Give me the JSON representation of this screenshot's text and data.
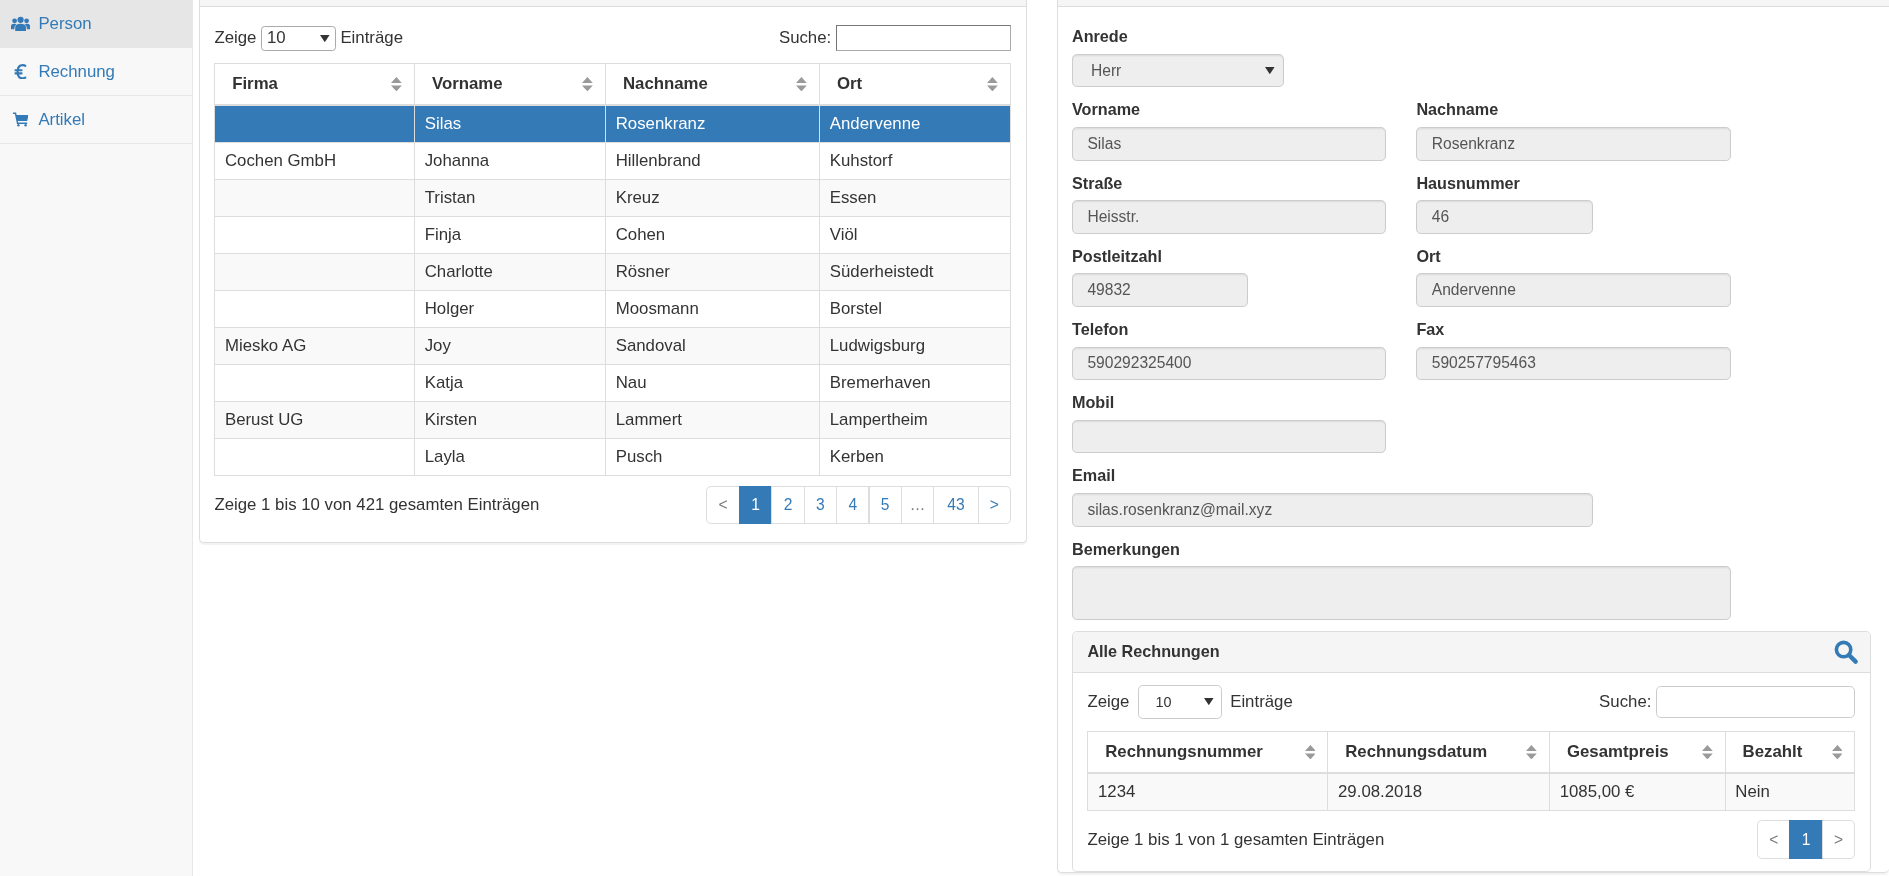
{
  "sidebar": {
    "items": [
      {
        "label": "Person",
        "selected": true
      },
      {
        "label": "Rechnung",
        "selected": false
      },
      {
        "label": "Artikel",
        "selected": false
      }
    ]
  },
  "persons": {
    "length": {
      "before": "Zeige",
      "value": "10",
      "after": "Einträge"
    },
    "search_label": "Suche:",
    "columns": [
      "Firma",
      "Vorname",
      "Nachname",
      "Ort"
    ],
    "rows": [
      {
        "vorname": "Silas",
        "nachname": "Rosenkranz",
        "ort": "Andervenne",
        "selected": true
      },
      {
        "firma": "Cochen GmbH",
        "vorname": "Johanna",
        "nachname": "Hillenbrand",
        "ort": "Kuhstorf",
        "selected": false
      },
      {
        "vorname": "Tristan",
        "nachname": "Kreuz",
        "ort": "Essen",
        "selected": false
      },
      {
        "vorname": "Finja",
        "nachname": "Cohen",
        "ort": "Viöl",
        "selected": false
      },
      {
        "vorname": "Charlotte",
        "nachname": "Rösner",
        "ort": "Süderheistedt",
        "selected": false
      },
      {
        "vorname": "Holger",
        "nachname": "Moosmann",
        "ort": "Borstel",
        "selected": false
      },
      {
        "firma": "Miesko AG",
        "vorname": "Joy",
        "nachname": "Sandoval",
        "ort": "Ludwigsburg",
        "selected": false
      },
      {
        "vorname": "Katja",
        "nachname": "Nau",
        "ort": "Bremerhaven",
        "selected": false
      },
      {
        "firma": "Berust UG",
        "vorname": "Kirsten",
        "nachname": "Lammert",
        "ort": "Lampertheim",
        "selected": false
      },
      {
        "vorname": "Layla",
        "nachname": "Pusch",
        "ort": "Kerben",
        "selected": false
      }
    ],
    "info": "Zeige 1 bis 10 von 421 gesamten Einträgen",
    "pagination": [
      {
        "label": "<",
        "selected": false,
        "disabled": true
      },
      {
        "label": "1",
        "selected": true,
        "disabled": false
      },
      {
        "label": "2",
        "selected": false,
        "disabled": false
      },
      {
        "label": "3",
        "selected": false,
        "disabled": false
      },
      {
        "label": "4",
        "selected": false,
        "disabled": false
      },
      {
        "label": "5",
        "selected": false,
        "disabled": false
      },
      {
        "label": "…",
        "selected": false,
        "disabled": true
      },
      {
        "label": "43",
        "selected": false,
        "disabled": false
      },
      {
        "label": ">",
        "selected": false,
        "disabled": false
      }
    ]
  },
  "form": {
    "rows": [
      [
        {
          "label": "Anrede",
          "value": "Herr",
          "kind": "select",
          "disabled": true
        }
      ],
      [
        {
          "label": "Vorname",
          "value": "Silas",
          "kind": "input",
          "disabled": true
        },
        {
          "label": "Nachname",
          "value": "Rosenkranz",
          "kind": "input",
          "disabled": true
        }
      ],
      [
        {
          "label": "Straße",
          "value": "Heisstr.",
          "kind": "input",
          "disabled": true
        },
        {
          "label": "Hausnummer",
          "value": "46",
          "kind": "input",
          "disabled": true
        }
      ],
      [
        {
          "label": "Postleitzahl",
          "value": "49832",
          "kind": "input",
          "disabled": true
        },
        {
          "label": "Ort",
          "value": "Andervenne",
          "kind": "input",
          "disabled": true
        }
      ],
      [
        {
          "label": "Telefon",
          "value": "590292325400",
          "kind": "input",
          "disabled": true
        },
        {
          "label": "Fax",
          "value": "590257795463",
          "kind": "input",
          "disabled": true
        }
      ],
      [
        {
          "label": "Mobil",
          "kind": "input",
          "disabled": true
        }
      ],
      [
        {
          "label": "Email",
          "value": "silas.rosenkranz@mail.xyz",
          "kind": "input",
          "disabled": true
        }
      ],
      [
        {
          "label": "Bemerkungen",
          "kind": "textarea",
          "disabled": true
        }
      ]
    ]
  },
  "invoices": {
    "title": "Alle Rechnungen",
    "length": {
      "before": "Zeige",
      "value": "10",
      "after": "Einträge"
    },
    "search_label": "Suche:",
    "columns": [
      "Rechnungsnummer",
      "Rechnungsdatum",
      "Gesamtpreis",
      "Bezahlt"
    ],
    "rows": [
      {
        "nummer": "1234",
        "datum": "29.08.2018",
        "preis": "1085,00 €",
        "bezahlt": "Nein",
        "selected": false
      }
    ],
    "info": "Zeige 1 bis 1 von 1 gesamten Einträgen",
    "pagination": [
      {
        "label": "<",
        "selected": false,
        "disabled": true
      },
      {
        "label": "1",
        "selected": true,
        "disabled": false
      },
      {
        "label": ">",
        "selected": false,
        "disabled": true
      }
    ]
  }
}
